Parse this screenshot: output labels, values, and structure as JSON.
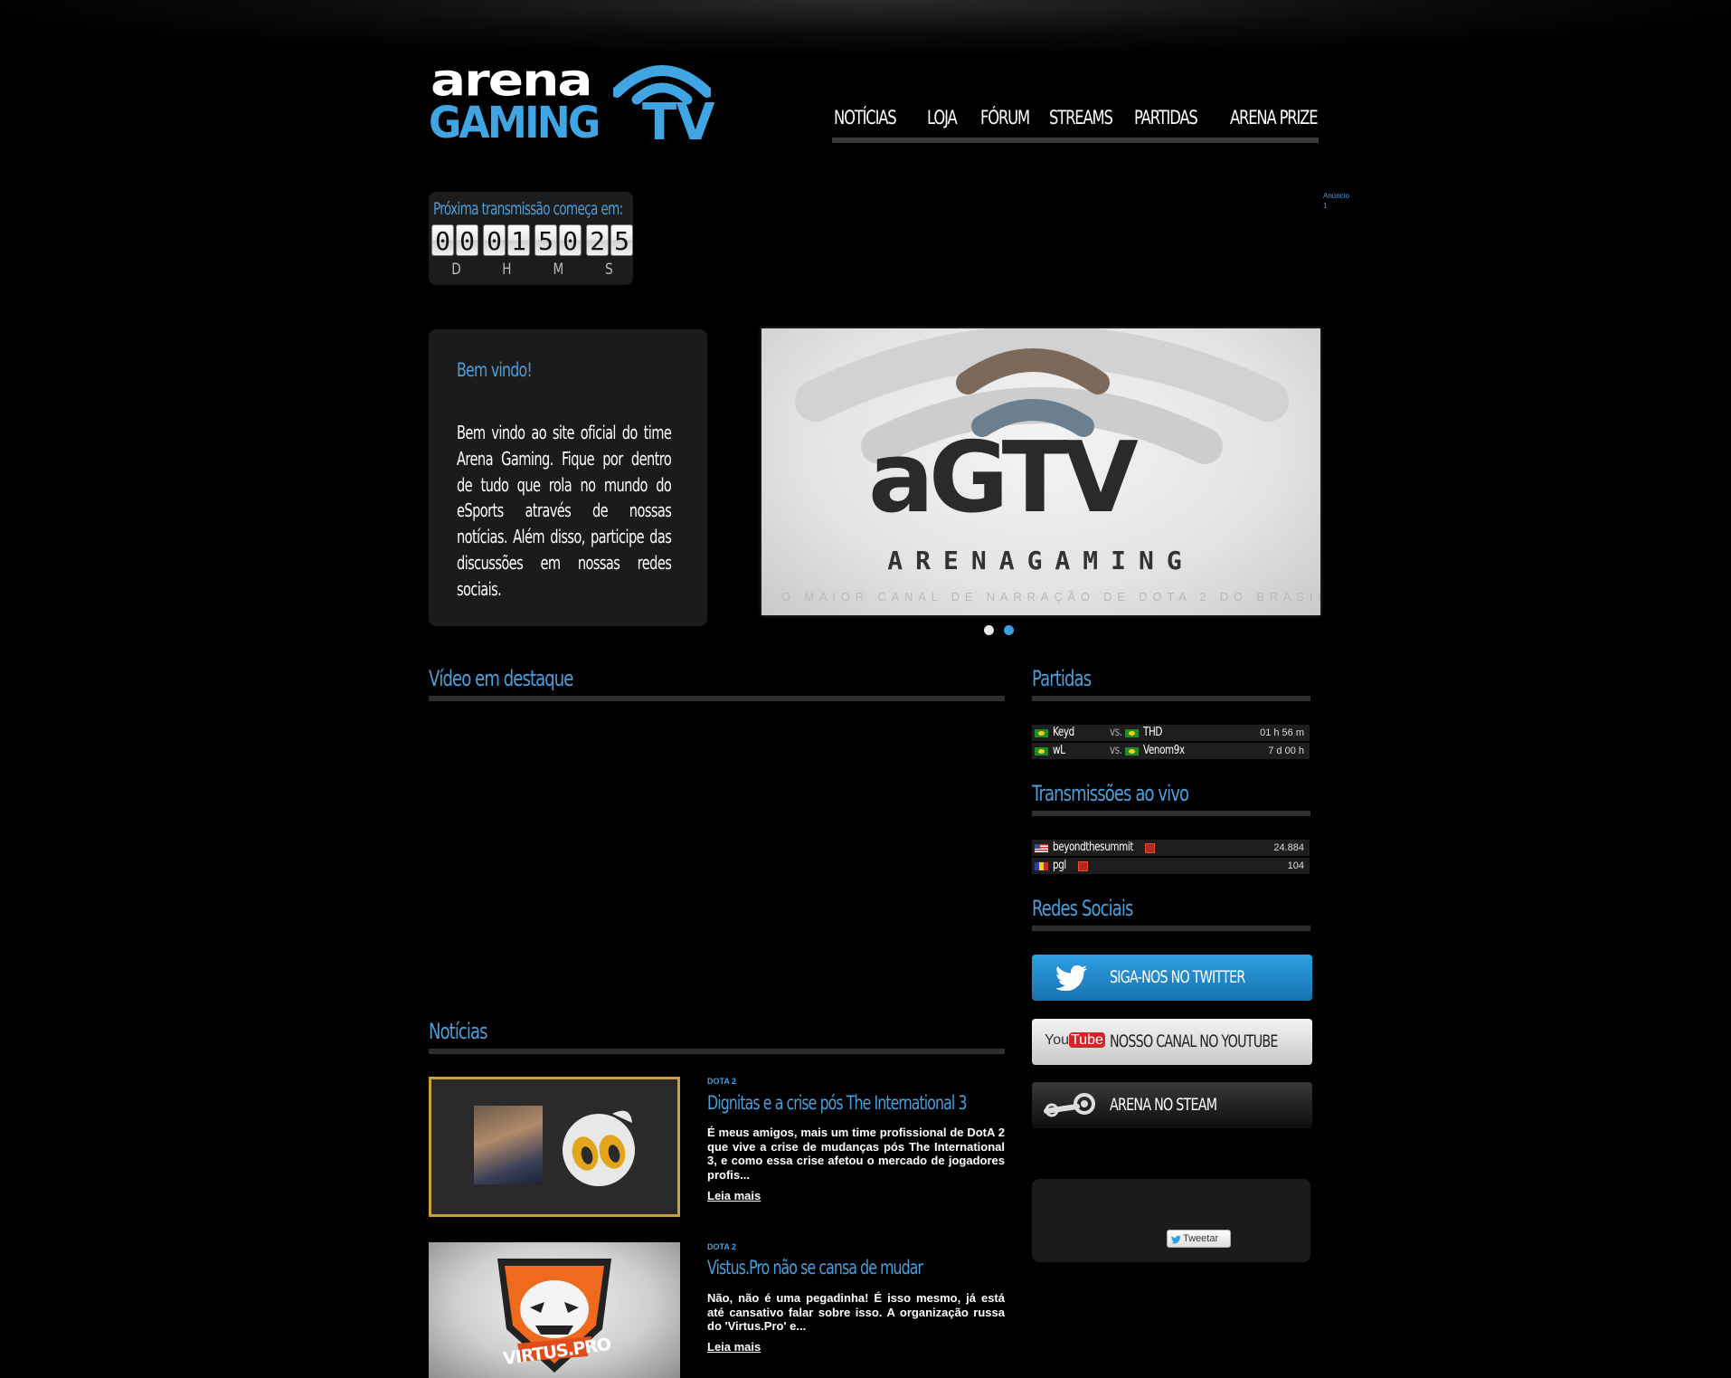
{
  "logo": {
    "line1": "arena",
    "line2": "GAMING",
    "line3": "TV"
  },
  "nav": {
    "items": [
      "NOTÍCIAS",
      "LOJA",
      "FÓRUM",
      "STREAMS",
      "PARTIDAS",
      "ARENA PRIZE"
    ]
  },
  "countdown": {
    "label": "Próxima transmissão começa em:",
    "digits": [
      "0",
      "0",
      "0",
      "1",
      "5",
      "0",
      "2",
      "5"
    ],
    "units": [
      "D",
      "H",
      "M",
      "S"
    ]
  },
  "ad": {
    "label_line1": "Anúncio",
    "label_line2": "1"
  },
  "welcome": {
    "title": "Bem vindo!",
    "body": "Bem vindo ao site oficial do time Arena Gaming. Fique por dentro de tudo que rola no mundo do eSports através de nossas notícias. Além disso, participe das discussões em nossas redes sociais."
  },
  "slider": {
    "logo_text": "aGTV",
    "brand": "ARENAGAMING",
    "tagline": "O MAIOR CANAL DE NARRAÇÃO DE DOTA 2 DO BRASIL",
    "active_index": 1
  },
  "featured_video": {
    "title": "Vídeo em destaque"
  },
  "matches": {
    "title": "Partidas",
    "rows": [
      {
        "team1": "Keyd",
        "vs": "vs.",
        "team2": "THD",
        "time": "01 h 56 m"
      },
      {
        "team1": "wL",
        "vs": "vs.",
        "team2": "Venom9x",
        "time": "7 d 00 h"
      }
    ]
  },
  "live": {
    "title": "Transmissões ao vivo",
    "rows": [
      {
        "channel": "beyondthesummit",
        "viewers": "24.884"
      },
      {
        "channel": "pgl",
        "viewers": "104"
      }
    ]
  },
  "social": {
    "title": "Redes Sociais",
    "twitter": "SIGA-NOS NO TWITTER",
    "youtube_you": "You",
    "youtube_tube": "Tube",
    "youtube": "NOSSO CANAL NO YOUTUBE",
    "steam": "ARENA NO STEAM",
    "tweet_button": "Tweetar"
  },
  "news": {
    "title": "Notícias",
    "items": [
      {
        "category": "DOTA 2",
        "title": "Dignitas e a crise pós The International 3",
        "excerpt": "É meus amigos, mais um time profissional de DotA 2 que vive a crise de mudanças pós The International 3, e como essa crise afetou o mercado de jogadores profis...",
        "more": "Leia mais"
      },
      {
        "category": "DOTA 2",
        "title": "Vistus.Pro não se cansa de mudar",
        "excerpt": "Não, não é uma pegadinha! É isso mesmo, já está até cansativo falar sobre isso. A organização russa do 'Virtus.Pro' e...",
        "more": "Leia mais",
        "thumb_text": "VIRTUS.PRO"
      }
    ]
  },
  "colors": {
    "accent": "#4a9fdc",
    "background": "#000000",
    "panel": "#1b1b1b",
    "thumb_border": "#c8a03c"
  }
}
